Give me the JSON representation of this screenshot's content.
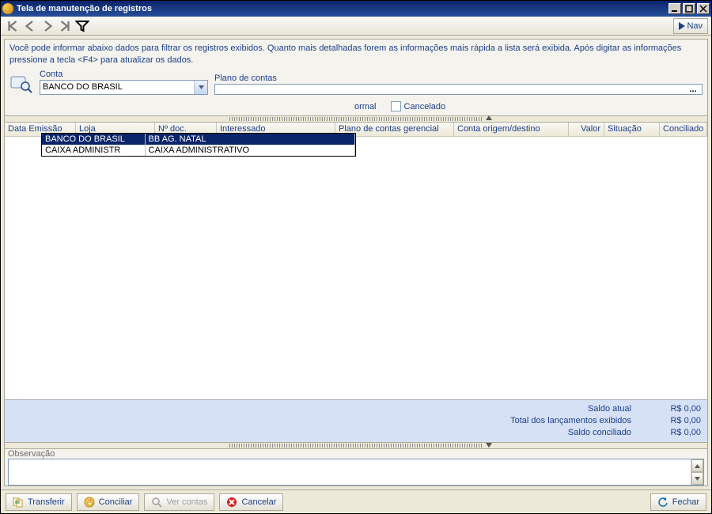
{
  "window": {
    "title": "Tela de manutenção de registros"
  },
  "toolbar": {
    "nav_label": "Nav"
  },
  "instructions": "Você pode informar abaixo dados para filtrar os registros exibidos. Quanto mais detalhadas forem as informações mais rápida a lista será exibida. Após digitar as informações pressione a tecla <F4> para atualizar os dados.",
  "filters": {
    "conta": {
      "label": "Conta",
      "value": "BANCO DO BRASIL"
    },
    "plano": {
      "label": "Plano de contas",
      "value": ""
    },
    "options": [
      {
        "code": "BANCO DO BRASIL",
        "desc": "BB AG. NATAL"
      },
      {
        "code": "CAIXA ADMINISTR",
        "desc": "CAIXA ADMINISTRATIVO"
      }
    ],
    "checkboxes": {
      "normal_label": "ormal",
      "cancelado_label": "Cancelado"
    }
  },
  "grid": {
    "columns": [
      "Data Emissão",
      "Loja",
      "Nº doc.",
      "Interessado",
      "Plano de contas gerencial",
      "Conta origem/destino",
      "Valor",
      "Situação",
      "Conciliado"
    ]
  },
  "totals": {
    "saldo_atual_label": "Saldo atual",
    "saldo_atual_value": "R$ 0,00",
    "total_lanc_label": "Total dos lançamentos exibidos",
    "total_lanc_value": "R$ 0,00",
    "saldo_conc_label": "Saldo conciliado",
    "saldo_conc_value": "R$ 0,00"
  },
  "observacao": {
    "label": "Observação"
  },
  "buttons": {
    "transferir": "Transferir",
    "conciliar": "Conciliar",
    "ver_contas": "Ver contas",
    "cancelar": "Cancelar",
    "fechar": "Fechar"
  }
}
